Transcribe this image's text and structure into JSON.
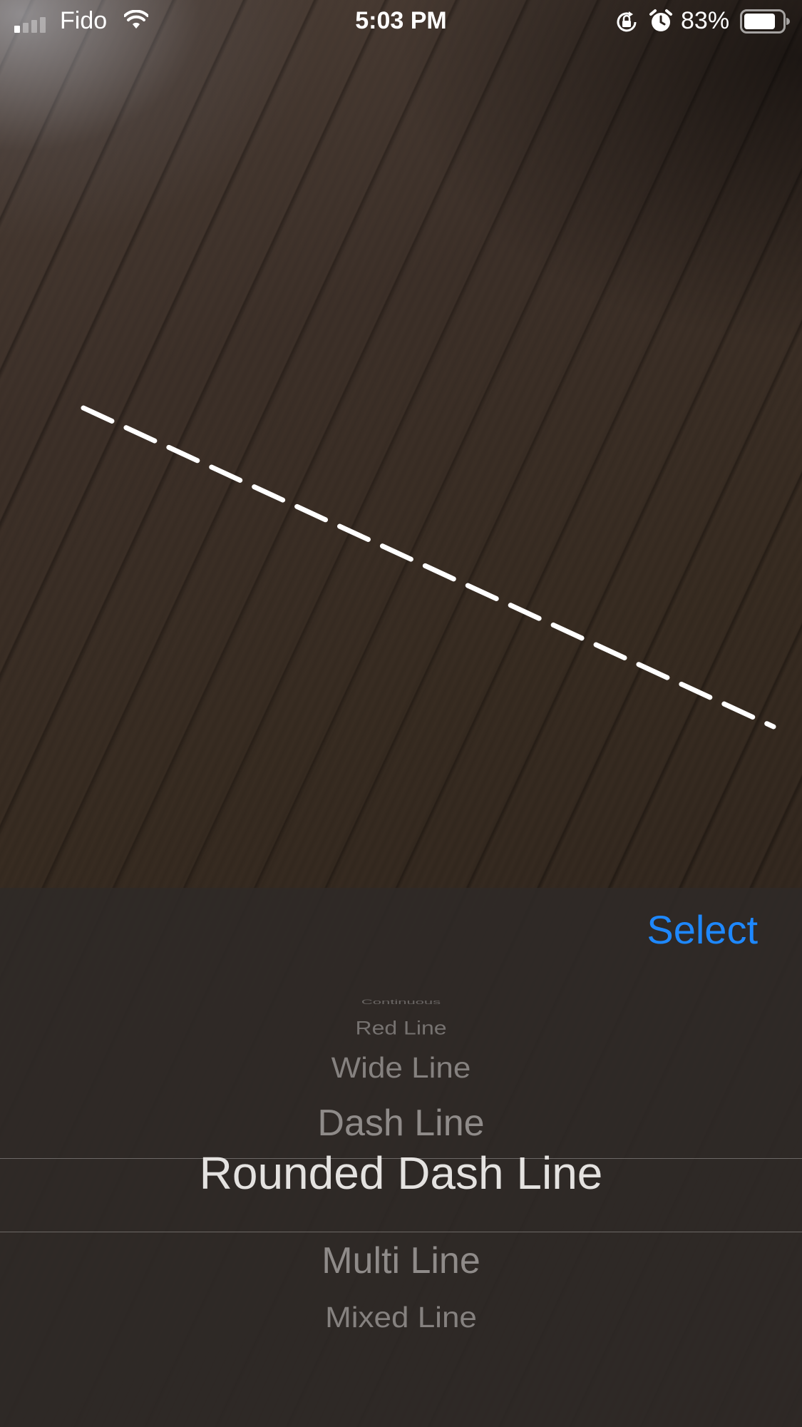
{
  "status_bar": {
    "carrier": "Fido",
    "time": "5:03 PM",
    "battery_percent": "83%",
    "signal_bars_active": 1,
    "signal_bars_total": 4,
    "battery_level": 0.83,
    "icons": [
      "signal-icon",
      "wifi-icon",
      "orientation-lock-icon",
      "alarm-icon",
      "battery-icon"
    ]
  },
  "ar_view": {
    "line_style": "dashed",
    "line_color": "#ffffff"
  },
  "picker": {
    "select_label": "Select",
    "select_color": "#1e88ff",
    "options": [
      "Continuous",
      "Red Line",
      "Wide Line",
      "Dash Line",
      "Rounded Dash Line",
      "Multi Line",
      "Mixed Line"
    ],
    "selected_option": "Rounded Dash Line"
  }
}
